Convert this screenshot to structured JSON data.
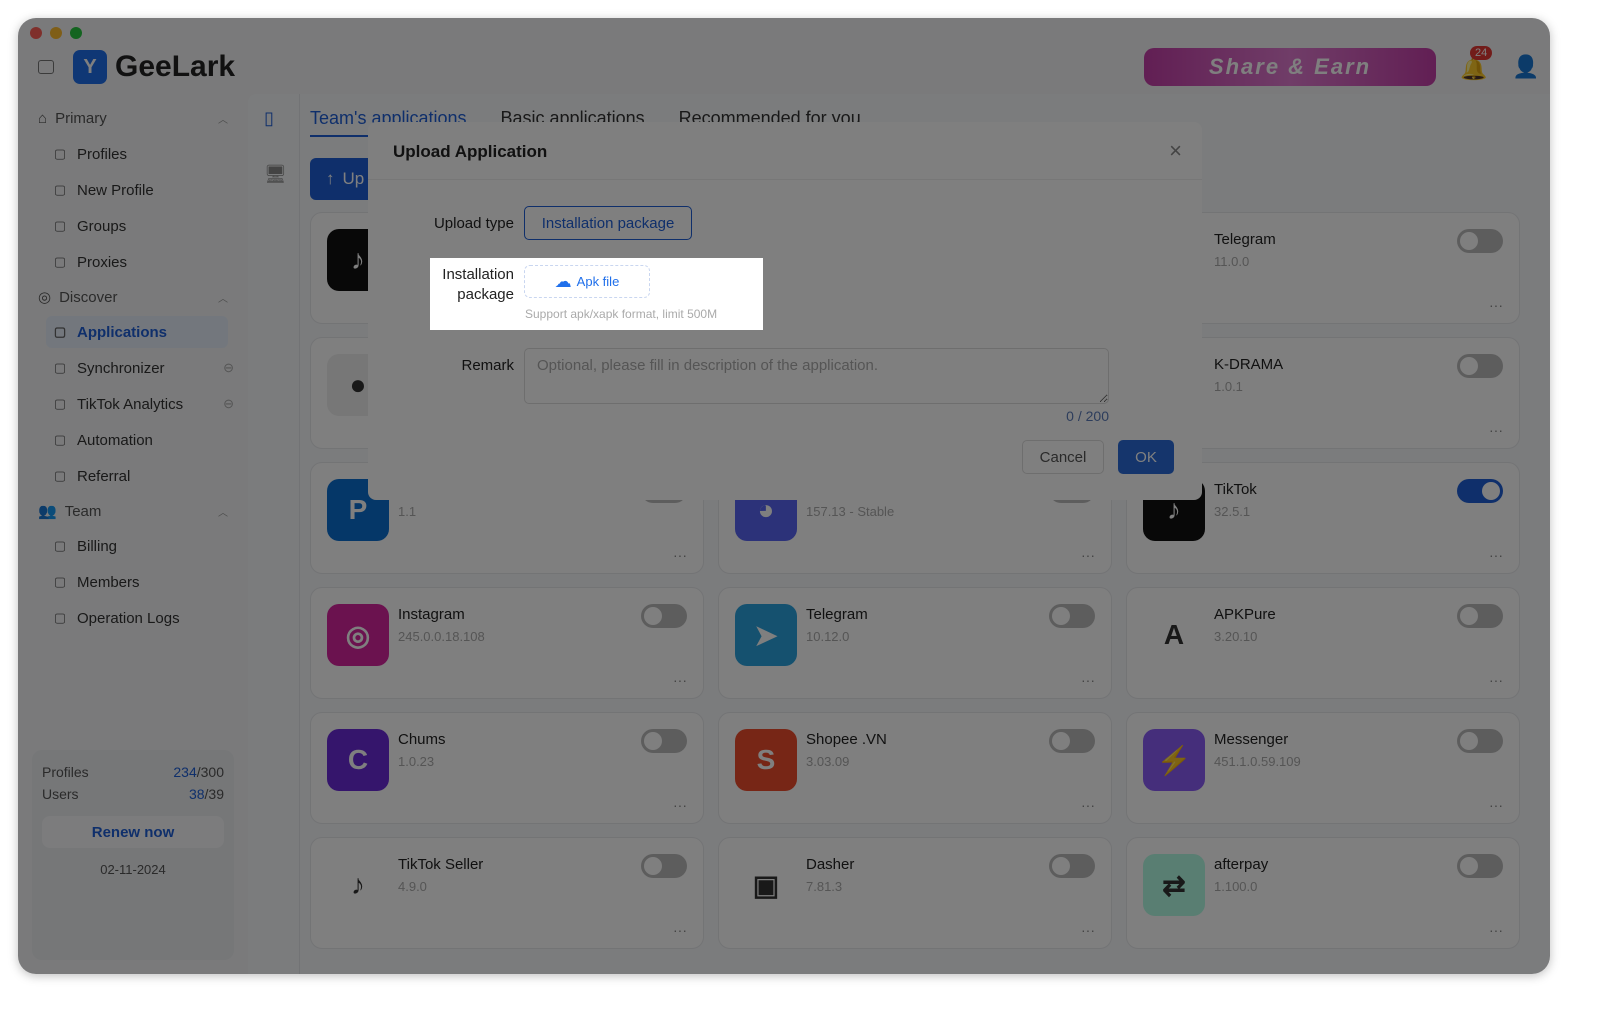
{
  "app": {
    "name": "GeeLark",
    "banner": "Share & Earn",
    "notifications": "24"
  },
  "sidebar": {
    "sections": [
      {
        "label": "Primary",
        "items": [
          {
            "label": "Profiles",
            "icon": "profiles-icon"
          },
          {
            "label": "New Profile",
            "icon": "edit-icon"
          },
          {
            "label": "Groups",
            "icon": "list-icon"
          },
          {
            "label": "Proxies",
            "icon": "proxy-icon"
          }
        ]
      },
      {
        "label": "Discover",
        "items": [
          {
            "label": "Applications",
            "icon": "apps-icon",
            "active": true
          },
          {
            "label": "Synchronizer",
            "icon": "sync-icon"
          },
          {
            "label": "TikTok Analytics",
            "icon": "chart-icon"
          },
          {
            "label": "Automation",
            "icon": "robot-icon"
          },
          {
            "label": "Referral",
            "icon": "gift-icon"
          }
        ]
      },
      {
        "label": "Team",
        "items": [
          {
            "label": "Billing",
            "icon": "billing-icon"
          },
          {
            "label": "Members",
            "icon": "members-icon"
          },
          {
            "label": "Operation Logs",
            "icon": "logs-icon"
          }
        ]
      }
    ],
    "quota": {
      "profiles_label": "Profiles",
      "profiles_used": "234",
      "profiles_total": "/300",
      "users_label": "Users",
      "users_used": "38",
      "users_total": "/39",
      "renew": "Renew now",
      "date": "02-11-2024"
    }
  },
  "main": {
    "tabs": [
      "Team's applications",
      "Basic applications",
      "Recommended for you"
    ],
    "upload_button": "Up",
    "apps": [
      {
        "name": "",
        "version": "",
        "color": "#111",
        "glyph": "♪",
        "on": false
      },
      {
        "name": "",
        "version": "",
        "color": "#fff",
        "glyph": "",
        "on": false
      },
      {
        "name": "Telegram",
        "version": "11.0.0",
        "color": "#fff",
        "glyph": "",
        "on": false
      },
      {
        "name": "",
        "version": "",
        "color": "#eee",
        "glyph": "●",
        "on": false
      },
      {
        "name": "",
        "version": "",
        "color": "#fff",
        "glyph": "",
        "on": false
      },
      {
        "name": "K-DRAMA",
        "version": "1.0.1",
        "color": "#fff",
        "glyph": "",
        "on": false
      },
      {
        "name": "",
        "version": "1.1",
        "color": "#0a6fd0",
        "glyph": "P",
        "on": false
      },
      {
        "name": "",
        "version": "157.13 - Stable",
        "color": "#5865f2",
        "glyph": "◕",
        "on": false
      },
      {
        "name": "TikTok",
        "version": "32.5.1",
        "color": "#111",
        "glyph": "♪",
        "on": true
      },
      {
        "name": "Instagram",
        "version": "245.0.0.18.108",
        "color": "#d6249f",
        "glyph": "◎",
        "on": false
      },
      {
        "name": "Telegram",
        "version": "10.12.0",
        "color": "#2aa3df",
        "glyph": "➤",
        "on": false
      },
      {
        "name": "APKPure",
        "version": "3.20.10",
        "color": "#fff",
        "glyph": "A",
        "on": false
      },
      {
        "name": "Chums",
        "version": "1.0.23",
        "color": "#6a2bd8",
        "glyph": "C",
        "on": false
      },
      {
        "name": "Shopee .VN",
        "version": "3.03.09",
        "color": "#ee4d2d",
        "glyph": "S",
        "on": false
      },
      {
        "name": "Messenger",
        "version": "451.1.0.59.109",
        "color": "#8a5cf6",
        "glyph": "⚡",
        "on": false
      },
      {
        "name": "TikTok Seller",
        "version": "4.9.0",
        "color": "#fff",
        "glyph": "♪",
        "on": false
      },
      {
        "name": "Dasher",
        "version": "7.81.3",
        "color": "#fff",
        "glyph": "▣",
        "on": false
      },
      {
        "name": "afterpay",
        "version": "1.100.0",
        "color": "#b2fce4",
        "glyph": "⇄",
        "on": false
      }
    ]
  },
  "modal": {
    "title": "Upload Application",
    "upload_type_label": "Upload type",
    "upload_type_value": "Installation package",
    "package_label": "Installation package",
    "apk_button": "Apk file",
    "hint": "Support apk/xapk format, limit 500M",
    "remark_label": "Remark",
    "remark_placeholder": "Optional, please fill in description of the application.",
    "remark_value": "",
    "count": "0 / 200",
    "cancel": "Cancel",
    "ok": "OK"
  },
  "colors": {
    "accent": "#1f5fd6",
    "overlay": "rgba(0,0,0,0.5)"
  }
}
